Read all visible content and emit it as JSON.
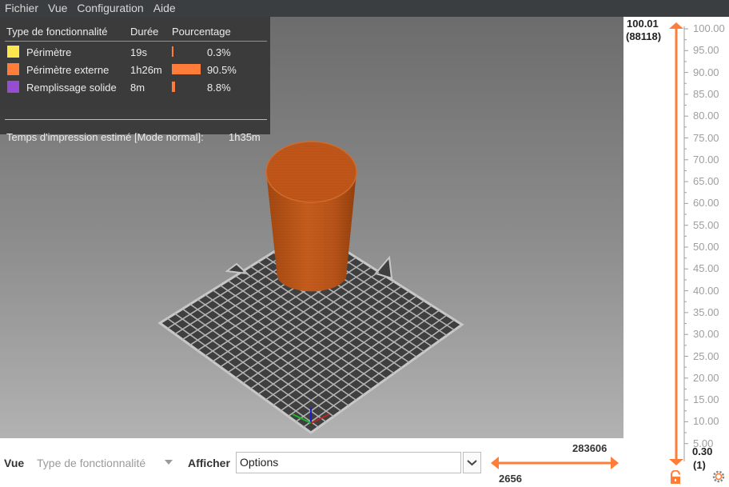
{
  "menubar": {
    "items": [
      "Fichier",
      "Vue",
      "Configuration",
      "Aide"
    ]
  },
  "legend": {
    "headers": {
      "type": "Type de fonctionnalité",
      "duration": "Durée",
      "percent": "Pourcentage"
    },
    "rows": [
      {
        "name": "Périmètre",
        "time": "19s",
        "percent_label": "0.3%",
        "percent": 0.3,
        "color": "#ffe64d"
      },
      {
        "name": "Périmètre externe",
        "time": "1h26m",
        "percent_label": "90.5%",
        "percent": 90.5,
        "color": "#ff7d38"
      },
      {
        "name": "Remplissage solide",
        "time": "8m",
        "percent_label": "8.8%",
        "percent": 8.8,
        "color": "#964dd1"
      }
    ],
    "estimate_label": "Temps d'impression estimé [Mode normal]:",
    "estimate_value": "1h35m"
  },
  "bottombar": {
    "view_label": "Vue",
    "feature_combo": "Type de fonctionnalité",
    "show_label": "Afficher",
    "options_value": "Options"
  },
  "h_slider": {
    "max_label": "283606",
    "min_label": "2656"
  },
  "v_slider": {
    "top_value": "100.01",
    "top_count": "(88118)",
    "bottom_value": "0.30",
    "bottom_count": "(1)",
    "ticks": [
      "100.00",
      "95.00",
      "90.00",
      "85.00",
      "80.00",
      "75.00",
      "70.00",
      "65.00",
      "60.00",
      "55.00",
      "50.00",
      "45.00",
      "40.00",
      "35.00",
      "30.00",
      "25.00",
      "20.00",
      "15.00",
      "10.00",
      "5.00"
    ]
  },
  "colors": {
    "accent": "#ff7d38",
    "object": "#c05a1c",
    "bed": "#3f3f3f",
    "bed_lines": "#bdbdbd"
  },
  "icons": [
    "grid-bed",
    "axes-gizmo",
    "lock-icon",
    "settings-gear-icon",
    "chevron-down-icon"
  ]
}
